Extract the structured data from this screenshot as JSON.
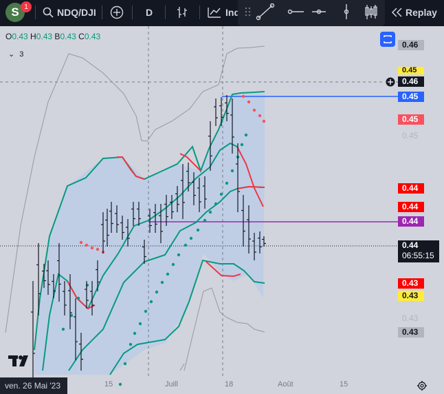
{
  "toolbar": {
    "avatar_letter": "S",
    "notification_count": "1",
    "symbol": "NDQ/DJI",
    "interval": "D",
    "indicators_label": "Ind",
    "replay_label": "Replay"
  },
  "legend": {
    "o_label": "O",
    "o_value": "0.43",
    "h_label": "H",
    "h_value": "0.43",
    "b_label": "B",
    "b_value": "0.43",
    "c_label": "C",
    "c_value": "0.43",
    "indicator_count": "3"
  },
  "price_axis": {
    "p046_top": "0.46",
    "p045_yellow": "0.45",
    "crosshair_price": "0.46",
    "p045_blue": "0.45",
    "p045_red": "0.45",
    "p045_plain": "0.45",
    "p044_red1": "0.44",
    "p044_red2": "0.44",
    "p044_purple": "0.44",
    "last_price": "0.44",
    "countdown": "06:55:15",
    "p043_red": "0.43",
    "p043_yellow": "0.43",
    "p043_plain": "0.43",
    "p043_gray": "0.43"
  },
  "time_axis": {
    "labels": [
      "15",
      "Juill",
      "18",
      "Août",
      "15"
    ],
    "cursor_date": "ven. 26 Mai '23"
  },
  "colors": {
    "background": "#d1d4dc",
    "band_fill": "#bccde6",
    "green": "#089981",
    "red": "#f23645",
    "blue": "#2962ff",
    "purple": "#9c27b0",
    "yellow": "#ffeb3b"
  },
  "icons": [
    "search-icon",
    "plus-circle-icon",
    "bar-chart-icon",
    "indicators-icon",
    "drag-handle-icon",
    "trendline-icon",
    "horizontal-ray-icon",
    "horizontal-line-icon",
    "vertical-line-icon",
    "candles-icon",
    "replay-icon",
    "crosshair-plus-icon",
    "resize-icon",
    "settings-gear-icon",
    "tradingview-logo-icon"
  ]
}
